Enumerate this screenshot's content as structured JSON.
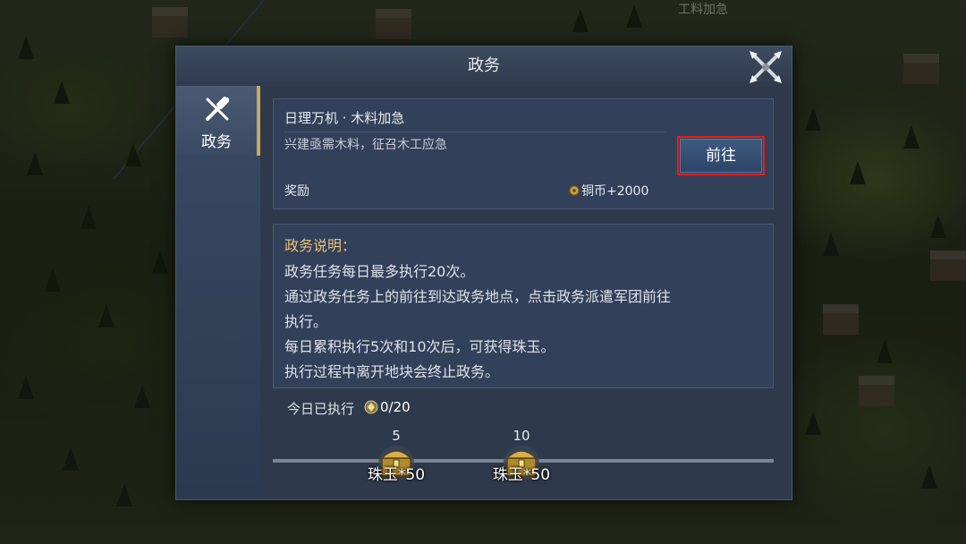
{
  "map": {
    "label": "工料加急"
  },
  "dialog": {
    "title": "政务",
    "close_icon": "close-crossed-blades-icon",
    "sidebar": {
      "tabs": [
        {
          "label": "政务",
          "icon": "quill-scroll-icon",
          "active": true
        }
      ]
    },
    "task": {
      "title": "日理万机 · 木料加急",
      "description": "兴建亟需木料，征召木工应急",
      "go_button": "前往",
      "reward_label": "奖励",
      "reward_icon": "copper-coin-icon",
      "reward_value": "铜币+2000"
    },
    "description": {
      "heading": "政务说明：",
      "lines": [
        "政务任务每日最多执行20次。",
        "通过政务任务上的前往到达政务地点，点击政务派遣军团前往",
        "执行。",
        "每日累积执行5次和10次后，可获得珠玉。",
        "执行过程中离开地块会终止政务。"
      ]
    },
    "progress": {
      "label": "今日已执行",
      "icon": "gem-icon",
      "count": "0/20",
      "fraction": 0,
      "milestones": [
        {
          "threshold": "5",
          "reward": "珠玉*50",
          "icon": "treasure-chest-icon"
        },
        {
          "threshold": "10",
          "reward": "珠玉*50",
          "icon": "treasure-chest-icon"
        }
      ]
    }
  },
  "colors": {
    "accent_gold": "#c9a862",
    "highlight_red": "#e0201c",
    "panel": "#2e3a4c"
  }
}
